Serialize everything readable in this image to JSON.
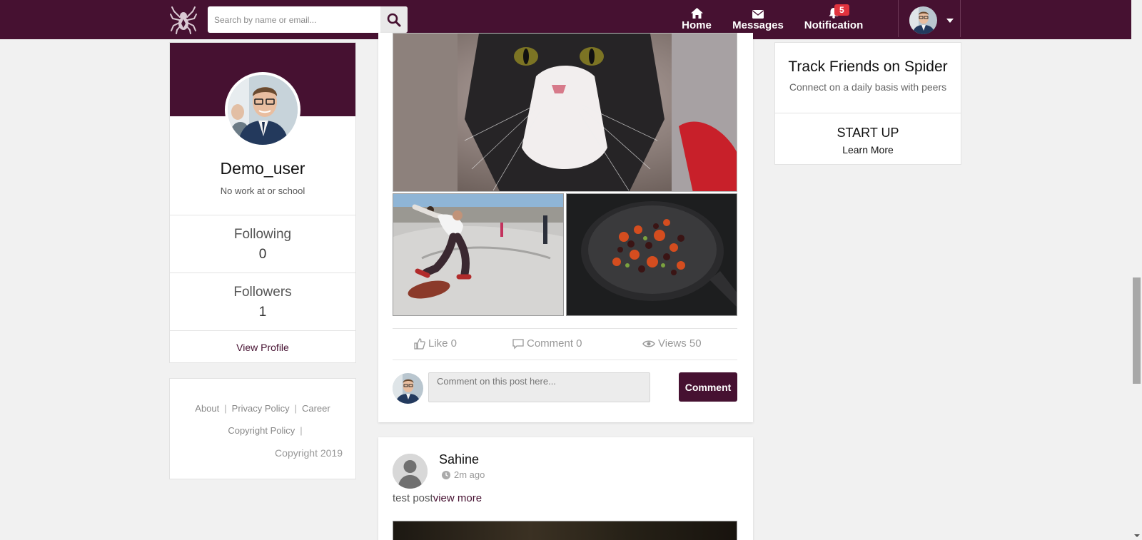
{
  "header": {
    "search_placeholder": "Search by name or email...",
    "nav": {
      "home": "Home",
      "messages": "Messages",
      "notification": "Notification",
      "notification_count": "5"
    },
    "brand_color": "#461131"
  },
  "profile": {
    "name": "Demo_user",
    "work": "No work at or school",
    "following_label": "Following",
    "following_count": "0",
    "followers_label": "Followers",
    "followers_count": "1",
    "view_profile": "View Profile"
  },
  "footer": {
    "links": [
      "About",
      "Privacy Policy",
      "Career",
      "Copyright Policy"
    ],
    "copyright": "Copyright 2019"
  },
  "post": {
    "images": [
      "cat-photo",
      "skateboarder-photo",
      "pan-food-photo"
    ],
    "like_label": "Like 0",
    "comment_label": "Comment 0",
    "views_label": "Views 50",
    "comment_placeholder": "Comment on this post here...",
    "comment_button": "Comment"
  },
  "post2": {
    "author": "Sahine",
    "time": "2m ago",
    "text": "test post",
    "more": "view more"
  },
  "sidebar_right": {
    "title": "Track Friends on Spider",
    "subtitle": "Connect on a daily basis with peers",
    "startup_title": "START UP",
    "learn_more": "Learn More"
  }
}
